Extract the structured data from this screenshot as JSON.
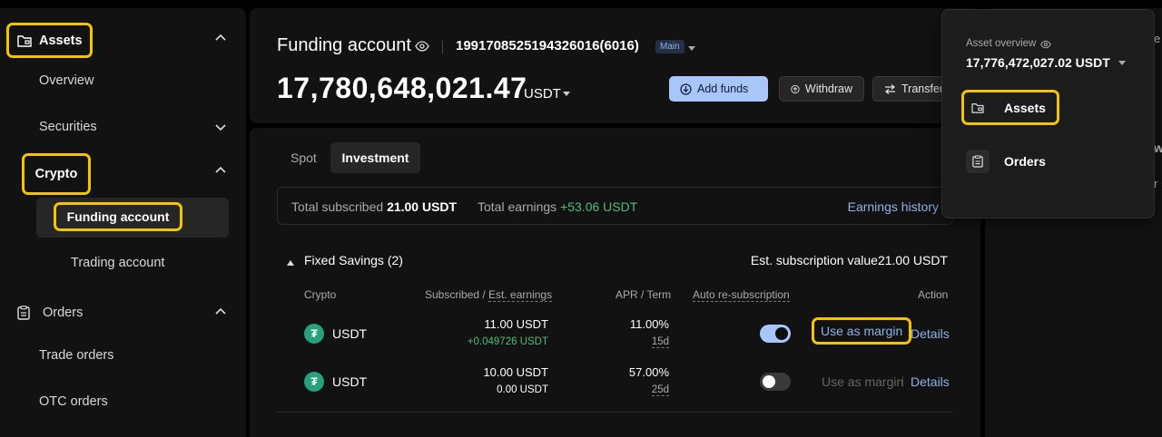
{
  "sidebar": {
    "assets_label": "Assets",
    "overview_label": "Overview",
    "securities_label": "Securities",
    "crypto_label": "Crypto",
    "funding_label": "Funding account",
    "trading_label": "Trading account",
    "orders_label": "Orders",
    "trade_orders_label": "Trade orders",
    "otc_orders_label": "OTC orders"
  },
  "header": {
    "title": "Funding account",
    "uid": "1991708525194326016(6016)",
    "badge": "Main",
    "balance": "17,780,648,021.47",
    "currency": "USDT",
    "add_funds_label": "Add funds",
    "withdraw_label": "Withdraw",
    "transfer_label": "Transfer"
  },
  "tabs": {
    "spot": "Spot",
    "investment": "Investment"
  },
  "summary": {
    "subscribed_label": "Total subscribed",
    "subscribed_value": "21.00 USDT",
    "earnings_label": "Total earnings",
    "earnings_value": "+53.06 USDT",
    "history_label": "Earnings history"
  },
  "fixed_savings": {
    "title": "Fixed Savings (2)",
    "est_label": "Est. subscription value",
    "est_value": "21.00 USDT"
  },
  "table": {
    "headers": {
      "crypto": "Crypto",
      "subscribed": "Subscribed /",
      "est_earnings": "Est. earnings",
      "apr_term": "APR / Term",
      "auto": "Auto re-subscription",
      "action": "Action"
    },
    "rows": [
      {
        "coin": "USDT",
        "subscribed": "11.00 USDT",
        "earnings": "+0.049726 USDT",
        "apr": "11.00%",
        "term": "15d",
        "auto": true,
        "margin_label": "Use as margin",
        "details_label": "Details"
      },
      {
        "coin": "USDT",
        "subscribed": "10.00 USDT",
        "earnings": "0.00 USDT",
        "apr": "57.00%",
        "term": "25d",
        "auto": false,
        "margin_label": "Use as margin",
        "details_label": "Details"
      }
    ]
  },
  "dropdown": {
    "overview_label": "Asset overview",
    "total": "17,776,472,027.02 USDT",
    "assets_label": "Assets",
    "orders_label": "Orders"
  },
  "right_fragments": {
    "f1": "e",
    "f2": "w",
    "f3": "r"
  },
  "colors": {
    "accent": "#a9c6fb",
    "highlight": "#f5c400",
    "positive": "#4ebd7a",
    "link": "#8fb2e8",
    "tether": "#26a17b"
  }
}
